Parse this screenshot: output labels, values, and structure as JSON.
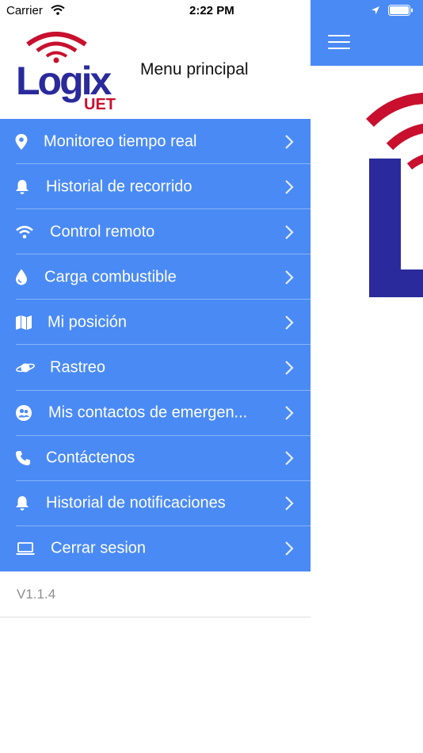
{
  "status_bar": {
    "carrier": "Carrier",
    "time": "2:22 PM"
  },
  "header": {
    "logo_text": "Logix",
    "logo_subtext": "UET",
    "title": "Menu principal"
  },
  "menu": {
    "items": [
      {
        "label": "Monitoreo tiempo real",
        "icon": "map-pin-icon"
      },
      {
        "label": "Historial de recorrido",
        "icon": "bell-icon"
      },
      {
        "label": "Control remoto",
        "icon": "wifi-icon"
      },
      {
        "label": "Carga combustible",
        "icon": "droplet-icon"
      },
      {
        "label": "Mi posición",
        "icon": "map-icon"
      },
      {
        "label": "Rastreo",
        "icon": "planet-icon"
      },
      {
        "label": "Mis contactos de emergen...",
        "icon": "contacts-icon"
      },
      {
        "label": "Contáctenos",
        "icon": "phone-icon"
      },
      {
        "label": "Historial de notificaciones",
        "icon": "bell-icon"
      },
      {
        "label": "Cerrar sesion",
        "icon": "laptop-icon"
      }
    ]
  },
  "footer": {
    "version": "V1.1.4"
  },
  "colors": {
    "menu_background": "#4a8af4",
    "logo_blue": "#2a2a9c",
    "logo_red": "#c8102e",
    "text_secondary": "#8e8e93"
  }
}
